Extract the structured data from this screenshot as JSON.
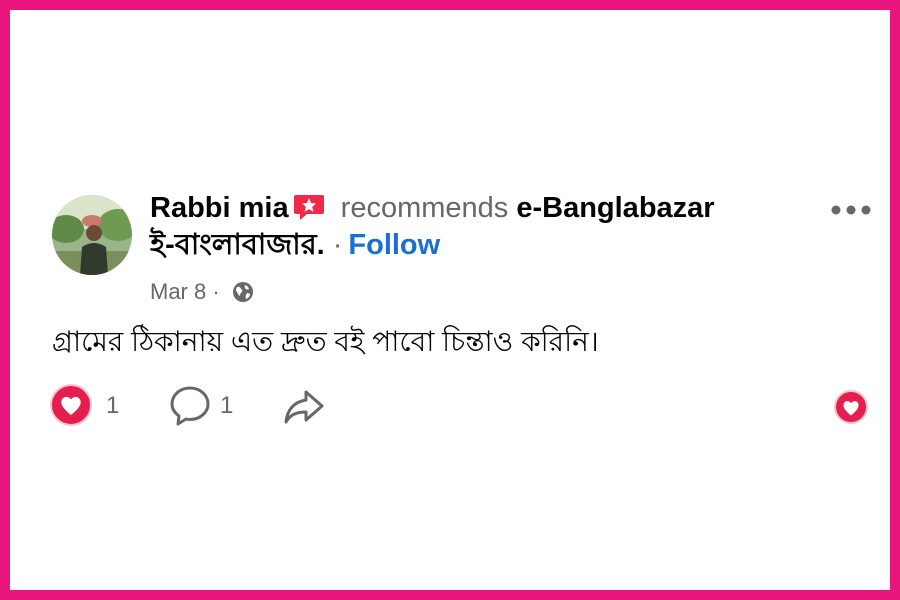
{
  "post": {
    "author": "Rabbi mia",
    "action": "recommends",
    "page_name_line1": "e-Banglabazar",
    "page_name_line2": "ই-বাংলাবাজার.",
    "separator": "·",
    "follow_label": "Follow",
    "date": "Mar 8",
    "meta_separator": "·",
    "text": "গ্রামের ঠিকানায় এত দ্রুত বই পাবো চিন্তাও করিনি।"
  },
  "actions": {
    "love_count": "1",
    "comment_count": "1"
  },
  "icons": {
    "recommend": "recommend-icon",
    "privacy": "globe-icon",
    "more": "more-options-icon",
    "love": "love-reaction-icon",
    "comment": "comment-icon",
    "share": "share-icon"
  },
  "colors": {
    "frame": "#e8157d",
    "follow": "#1b6fd1",
    "love": "#e41e4f",
    "recommend": "#f02849"
  }
}
